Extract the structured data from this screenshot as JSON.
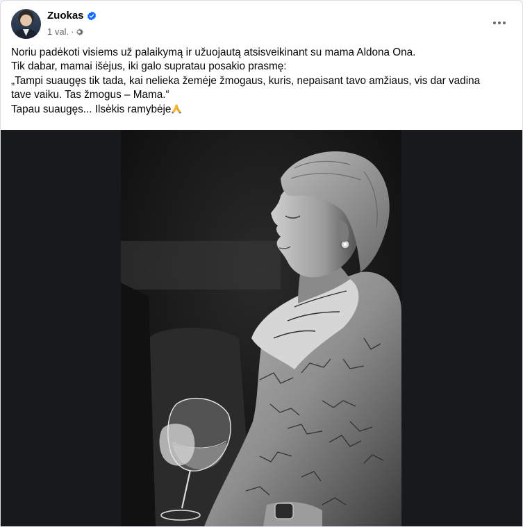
{
  "post": {
    "author": "Zuokas",
    "time": "1 val.",
    "separator": "·",
    "verified_color": "#0866ff",
    "text": {
      "line1": "Noriu padėkoti visiems už palaikymą ir užuojautą atsisveikinant su mama Aldona Ona.",
      "line2": "Tik dabar, mamai išėjus, iki galo supratau posakio prasmę:",
      "line3": "„Tampi suaugęs tik tada, kai nelieka žemėje žmogaus, kuris, nepaisant tavo amžiaus, vis dar vadina",
      "line4": "tave vaiku. Tas žmogus – Mama.“",
      "line5": "Tapau suaugęs... Ilsėkis ramybėje"
    },
    "photo_description_icon": "black-and-white-portrait",
    "icons": {
      "verified": "verified-badge-icon",
      "privacy": "gear-icon",
      "more": "more-options-icon",
      "prayer": "folded-hands-emoji"
    }
  }
}
